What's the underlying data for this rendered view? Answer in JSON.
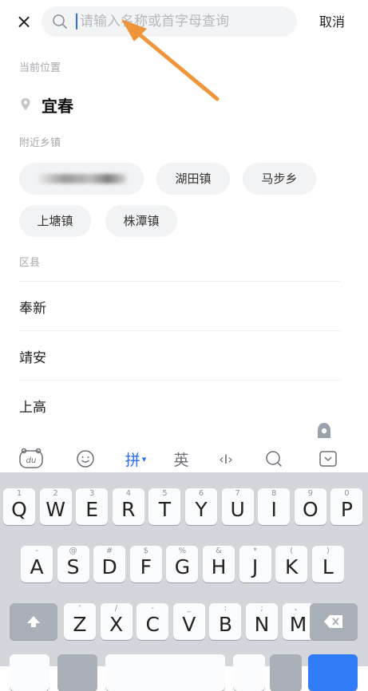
{
  "topbar": {
    "close_glyph": "×",
    "search_placeholder": "请输入名称或首字母查询",
    "cancel_label": "取消"
  },
  "current_location": {
    "label": "当前位置",
    "city": "宜春"
  },
  "nearby": {
    "label": "附近乡镇",
    "towns": [
      "湖田镇",
      "马步乡",
      "上塘镇",
      "株潭镇"
    ]
  },
  "county": {
    "label": "区县",
    "items": [
      "奉新",
      "靖安",
      "上高"
    ]
  },
  "keyboard_toolbar": {
    "du": "du",
    "pinyin": "拼",
    "english": "英",
    "cursor": "‹I›"
  },
  "keyboard": {
    "row1": [
      {
        "main": "Q",
        "sub": "1"
      },
      {
        "main": "W",
        "sub": "2"
      },
      {
        "main": "E",
        "sub": "3"
      },
      {
        "main": "R",
        "sub": "4"
      },
      {
        "main": "T",
        "sub": "5"
      },
      {
        "main": "Y",
        "sub": "6"
      },
      {
        "main": "U",
        "sub": "7"
      },
      {
        "main": "I",
        "sub": "8"
      },
      {
        "main": "O",
        "sub": "9"
      },
      {
        "main": "P",
        "sub": "0"
      }
    ],
    "row2": [
      {
        "main": "A",
        "sub": "-"
      },
      {
        "main": "S",
        "sub": "@"
      },
      {
        "main": "D",
        "sub": "#"
      },
      {
        "main": "F",
        "sub": "$"
      },
      {
        "main": "G",
        "sub": "%"
      },
      {
        "main": "H",
        "sub": "&"
      },
      {
        "main": "J",
        "sub": "*"
      },
      {
        "main": "K",
        "sub": "("
      },
      {
        "main": "L",
        "sub": ")"
      }
    ],
    "row3": [
      {
        "main": "Z",
        "sub": "'"
      },
      {
        "main": "X",
        "sub": "/"
      },
      {
        "main": "C",
        "sub": "-"
      },
      {
        "main": "V",
        "sub": "_"
      },
      {
        "main": "B",
        "sub": ":"
      },
      {
        "main": "N",
        "sub": ";"
      },
      {
        "main": "M",
        "sub": "、"
      }
    ]
  },
  "colors": {
    "accent": "#2a6cf6",
    "arrow": "#f0963a",
    "chip_bg": "#f2f3f5",
    "keyboard_bg": "#d3d7dc"
  }
}
